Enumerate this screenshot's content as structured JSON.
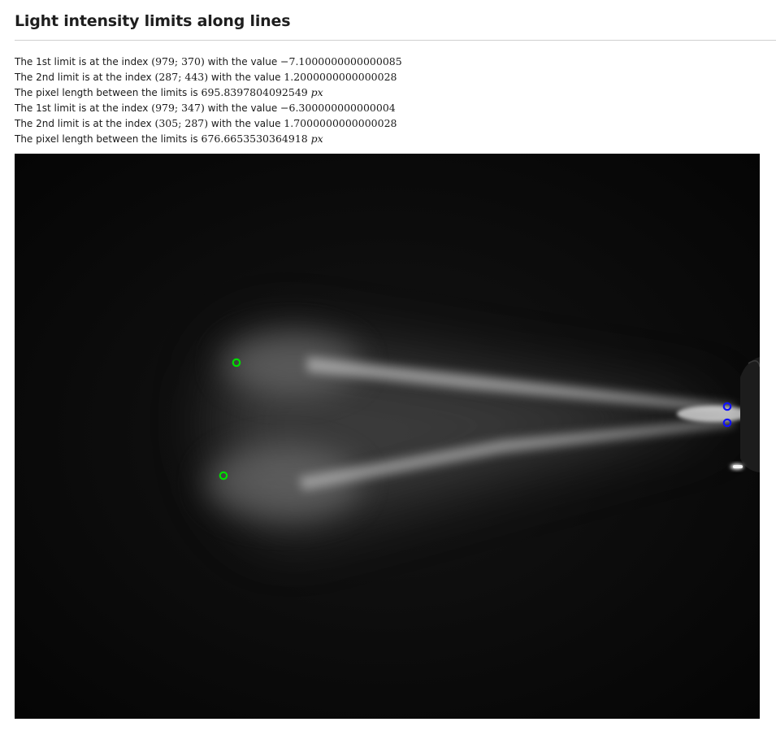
{
  "page": {
    "title": "Light intensity limits along lines"
  },
  "results": [
    {
      "prefix": "The 1st limit is at the index ",
      "index": "(979; 370)",
      "middle": " with the value ",
      "value": "−7.1000000000000085"
    },
    {
      "prefix": "The 2nd limit is at the index ",
      "index": "(287; 443)",
      "middle": " with the value ",
      "value": "1.2000000000000028"
    },
    {
      "prefix": "The pixel length between the limits is ",
      "length": "695.8397804092549",
      "unit": "px"
    },
    {
      "prefix": "The 1st limit is at the index ",
      "index": "(979; 347)",
      "middle": " with the value ",
      "value": "−6.300000000000004"
    },
    {
      "prefix": "The 2nd limit is at the index ",
      "index": "(305; 287)",
      "middle": " with the value ",
      "value": "1.7000000000000028"
    },
    {
      "prefix": "The pixel length between the limits is ",
      "length": "676.6653530364918",
      "unit": "px"
    }
  ],
  "markers": {
    "first_limit_color": "#1010ff",
    "second_limit_color": "#00e000"
  }
}
